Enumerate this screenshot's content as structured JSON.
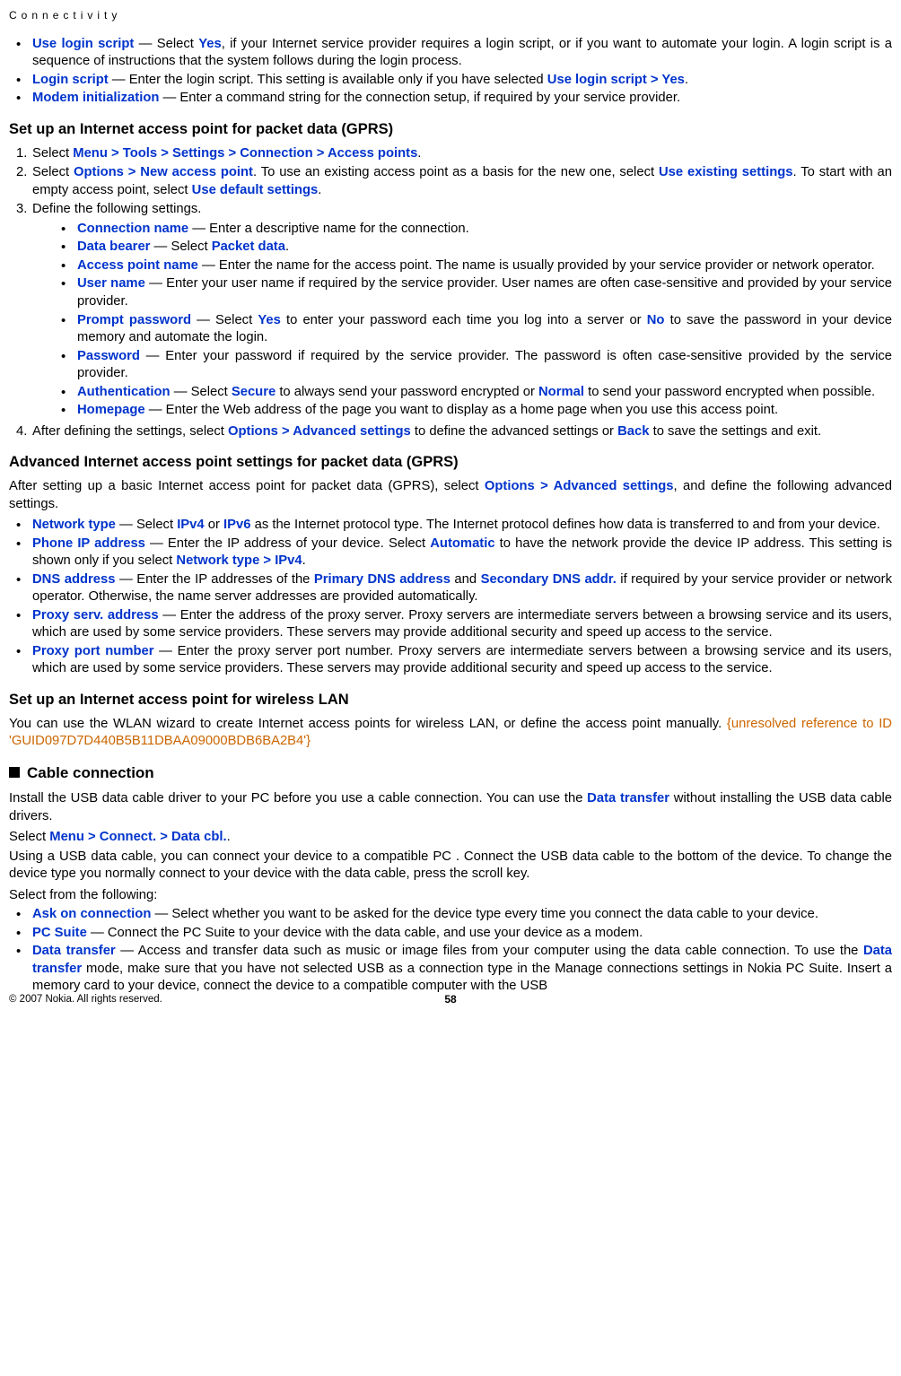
{
  "header": "Connectivity",
  "intro_bullets": [
    {
      "term": "Use login script",
      "sep": " — Select ",
      "v1": "Yes",
      "rest": ", if your Internet service provider requires a login script, or if you want to automate your login. A login script is a sequence of instructions that the system follows during the login process."
    },
    {
      "term": "Login script",
      "rest1": " — Enter the login script. This setting is available only if you have selected ",
      "v1": "Use login script",
      "gt": " > ",
      "v2": "Yes",
      "rest2": "."
    },
    {
      "term": "Modem initialization",
      "rest": " — Enter a command string for the connection setup, if required by your service provider."
    }
  ],
  "gprs": {
    "heading": "Set up an Internet access point for packet data (GPRS)",
    "step1": {
      "pre": "Select ",
      "m": "Menu",
      "g": " > ",
      "t": "Tools",
      "s": "Settings",
      "c": "Connection",
      "a": "Access points",
      "post": "."
    },
    "step2": {
      "pre": "Select ",
      "o": "Options",
      "g": " > ",
      "n": "New access point",
      "mid1": ". To use an existing access point as a basis for the new one, select ",
      "ue": "Use existing settings",
      "mid2": ". To start with an empty access point, select ",
      "ud": "Use default settings",
      "post": "."
    },
    "step3_label": "Define the following settings.",
    "step3_items": [
      {
        "term": "Connection name",
        "rest": " — Enter a descriptive name for the connection."
      },
      {
        "term": "Data bearer",
        "mid": " — Select ",
        "v": "Packet data",
        "post": "."
      },
      {
        "term": "Access point name",
        "rest": " — Enter the name for the access point. The name is usually provided by your service provider or network operator."
      },
      {
        "term": "User name",
        "rest": " — Enter your user name if required by the service provider. User names are often case-sensitive and provided by your service provider."
      },
      {
        "term": "Prompt password",
        "mid1": " — Select ",
        "v1": "Yes",
        "mid2": " to enter your password each time you log into a server or ",
        "v2": "No",
        "rest": " to save the password in your device memory and automate the login."
      },
      {
        "term": "Password",
        "rest": " — Enter your password if required by the service provider. The password is often case-sensitive provided by the service provider."
      },
      {
        "term": "Authentication",
        "mid1": " — Select ",
        "v1": "Secure",
        "mid2": " to always send your password encrypted or ",
        "v2": "Normal",
        "rest": " to send your password encrypted when possible."
      },
      {
        "term": "Homepage",
        "rest": " — Enter the Web address of the page you want to display as a home page when you use this access point."
      }
    ],
    "step4": {
      "pre": "After defining the settings, select ",
      "o": "Options",
      "g": " > ",
      "a": "Advanced settings",
      "mid": " to define the advanced settings or ",
      "b": "Back",
      "post": " to save the settings and exit."
    }
  },
  "adv": {
    "heading": "Advanced Internet access point settings for packet data (GPRS)",
    "intro_pre": "After setting up a basic Internet access point for packet data (GPRS), select ",
    "o": "Options",
    "g": " > ",
    "a": "Advanced settings",
    "intro_post": ", and define the following advanced settings.",
    "items": [
      {
        "term": "Network type",
        "mid1": " — Select ",
        "v1": "IPv4",
        "mid2": " or ",
        "v2": "IPv6",
        "rest": " as the Internet protocol type. The Internet protocol defines how data is transferred to and from your device."
      },
      {
        "term": "Phone IP address",
        "mid1": " — Enter the IP address of your device. Select ",
        "v1": "Automatic",
        "mid2": " to have the network provide the device IP address. This setting is shown only if you select ",
        "v2": "Network type",
        "g": " > ",
        "v3": "IPv4",
        "post": "."
      },
      {
        "term": "DNS address",
        "mid1": " — Enter the IP addresses of the ",
        "v1": "Primary DNS address",
        "mid2": " and ",
        "v2": "Secondary DNS addr.",
        "rest": " if required by your service provider or network operator. Otherwise, the name server addresses are provided automatically."
      },
      {
        "term": "Proxy serv. address",
        "rest": " — Enter the address of the proxy server. Proxy servers are intermediate servers between a browsing service and its users, which are used by some service providers. These servers may provide additional security and speed up access to the service."
      },
      {
        "term": "Proxy port number",
        "rest": " — Enter the proxy server port number. Proxy servers are intermediate servers between a browsing service and its users, which are used by some service providers. These servers may provide additional security and speed up access to the service."
      }
    ]
  },
  "wlan": {
    "heading": "Set up an Internet access point for wireless LAN",
    "pre": "You can use the WLAN wizard to create Internet access points for wireless LAN, or define the access point manually. ",
    "err": "{unresolved reference to ID 'GUID097D7D440B5B11DBAA09000BDB6BA2B4'}"
  },
  "cable": {
    "heading": "Cable connection",
    "p1_pre": "Install the USB data cable driver to your PC before you use a cable connection. You can use the ",
    "p1_term": "Data transfer",
    "p1_post": " without installing the USB data cable drivers.",
    "p2_pre": "Select ",
    "m": "Menu",
    "g": " > ",
    "c": "Connect.",
    "d": "Data cbl.",
    "p2_post": ".",
    "p3": "Using a USB data cable, you can connect your device to a compatible PC . Connect the USB data cable to the bottom of the device. To change the device type you normally connect to your device with the data cable, press the scroll key.",
    "p4": "Select from the following:",
    "items": [
      {
        "term": "Ask on connection",
        "rest": " — Select whether you want to be asked for the device type every time you connect the data cable to your device."
      },
      {
        "term": "PC Suite",
        "rest": " — Connect the PC Suite to your device with the data cable, and use your device as a modem."
      },
      {
        "term": "Data transfer",
        "mid1": " — Access and transfer data such as music or image files from your computer using the data cable connection. To use the ",
        "v1": "Data transfer",
        "rest": " mode, make sure that you have not selected USB as a connection type in the Manage connections settings in Nokia PC Suite. Insert a memory card to your device, connect the device to a compatible computer with the USB"
      }
    ]
  },
  "footer": {
    "copyright": "© 2007 Nokia. All rights reserved.",
    "page": "58"
  }
}
